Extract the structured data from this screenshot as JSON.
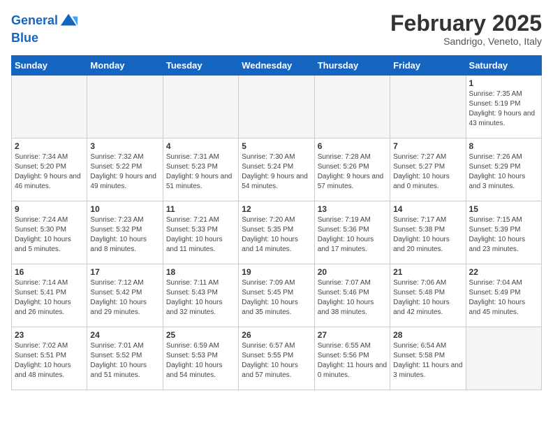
{
  "header": {
    "logo_line1": "General",
    "logo_line2": "Blue",
    "month": "February 2025",
    "location": "Sandrigo, Veneto, Italy"
  },
  "weekdays": [
    "Sunday",
    "Monday",
    "Tuesday",
    "Wednesday",
    "Thursday",
    "Friday",
    "Saturday"
  ],
  "weeks": [
    [
      {
        "day": "",
        "info": ""
      },
      {
        "day": "",
        "info": ""
      },
      {
        "day": "",
        "info": ""
      },
      {
        "day": "",
        "info": ""
      },
      {
        "day": "",
        "info": ""
      },
      {
        "day": "",
        "info": ""
      },
      {
        "day": "1",
        "info": "Sunrise: 7:35 AM\nSunset: 5:19 PM\nDaylight: 9 hours and 43 minutes."
      }
    ],
    [
      {
        "day": "2",
        "info": "Sunrise: 7:34 AM\nSunset: 5:20 PM\nDaylight: 9 hours and 46 minutes."
      },
      {
        "day": "3",
        "info": "Sunrise: 7:32 AM\nSunset: 5:22 PM\nDaylight: 9 hours and 49 minutes."
      },
      {
        "day": "4",
        "info": "Sunrise: 7:31 AM\nSunset: 5:23 PM\nDaylight: 9 hours and 51 minutes."
      },
      {
        "day": "5",
        "info": "Sunrise: 7:30 AM\nSunset: 5:24 PM\nDaylight: 9 hours and 54 minutes."
      },
      {
        "day": "6",
        "info": "Sunrise: 7:28 AM\nSunset: 5:26 PM\nDaylight: 9 hours and 57 minutes."
      },
      {
        "day": "7",
        "info": "Sunrise: 7:27 AM\nSunset: 5:27 PM\nDaylight: 10 hours and 0 minutes."
      },
      {
        "day": "8",
        "info": "Sunrise: 7:26 AM\nSunset: 5:29 PM\nDaylight: 10 hours and 3 minutes."
      }
    ],
    [
      {
        "day": "9",
        "info": "Sunrise: 7:24 AM\nSunset: 5:30 PM\nDaylight: 10 hours and 5 minutes."
      },
      {
        "day": "10",
        "info": "Sunrise: 7:23 AM\nSunset: 5:32 PM\nDaylight: 10 hours and 8 minutes."
      },
      {
        "day": "11",
        "info": "Sunrise: 7:21 AM\nSunset: 5:33 PM\nDaylight: 10 hours and 11 minutes."
      },
      {
        "day": "12",
        "info": "Sunrise: 7:20 AM\nSunset: 5:35 PM\nDaylight: 10 hours and 14 minutes."
      },
      {
        "day": "13",
        "info": "Sunrise: 7:19 AM\nSunset: 5:36 PM\nDaylight: 10 hours and 17 minutes."
      },
      {
        "day": "14",
        "info": "Sunrise: 7:17 AM\nSunset: 5:38 PM\nDaylight: 10 hours and 20 minutes."
      },
      {
        "day": "15",
        "info": "Sunrise: 7:15 AM\nSunset: 5:39 PM\nDaylight: 10 hours and 23 minutes."
      }
    ],
    [
      {
        "day": "16",
        "info": "Sunrise: 7:14 AM\nSunset: 5:41 PM\nDaylight: 10 hours and 26 minutes."
      },
      {
        "day": "17",
        "info": "Sunrise: 7:12 AM\nSunset: 5:42 PM\nDaylight: 10 hours and 29 minutes."
      },
      {
        "day": "18",
        "info": "Sunrise: 7:11 AM\nSunset: 5:43 PM\nDaylight: 10 hours and 32 minutes."
      },
      {
        "day": "19",
        "info": "Sunrise: 7:09 AM\nSunset: 5:45 PM\nDaylight: 10 hours and 35 minutes."
      },
      {
        "day": "20",
        "info": "Sunrise: 7:07 AM\nSunset: 5:46 PM\nDaylight: 10 hours and 38 minutes."
      },
      {
        "day": "21",
        "info": "Sunrise: 7:06 AM\nSunset: 5:48 PM\nDaylight: 10 hours and 42 minutes."
      },
      {
        "day": "22",
        "info": "Sunrise: 7:04 AM\nSunset: 5:49 PM\nDaylight: 10 hours and 45 minutes."
      }
    ],
    [
      {
        "day": "23",
        "info": "Sunrise: 7:02 AM\nSunset: 5:51 PM\nDaylight: 10 hours and 48 minutes."
      },
      {
        "day": "24",
        "info": "Sunrise: 7:01 AM\nSunset: 5:52 PM\nDaylight: 10 hours and 51 minutes."
      },
      {
        "day": "25",
        "info": "Sunrise: 6:59 AM\nSunset: 5:53 PM\nDaylight: 10 hours and 54 minutes."
      },
      {
        "day": "26",
        "info": "Sunrise: 6:57 AM\nSunset: 5:55 PM\nDaylight: 10 hours and 57 minutes."
      },
      {
        "day": "27",
        "info": "Sunrise: 6:55 AM\nSunset: 5:56 PM\nDaylight: 11 hours and 0 minutes."
      },
      {
        "day": "28",
        "info": "Sunrise: 6:54 AM\nSunset: 5:58 PM\nDaylight: 11 hours and 3 minutes."
      },
      {
        "day": "",
        "info": ""
      }
    ]
  ]
}
